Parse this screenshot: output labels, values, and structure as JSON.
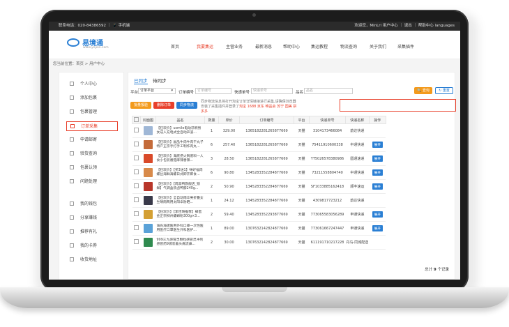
{
  "topbar": {
    "left": "联系电话：020-84386592 ｜ 📱 手机端",
    "right": "欢迎您，MinLrl  用户中心 ｜ 退出 ｜ 帮助中心 languages"
  },
  "logo": {
    "name": "易境通",
    "sub": "www.yejoin.com"
  },
  "nav": [
    "首页",
    "我要集运",
    "主营业务",
    "最新消息",
    "帮助中心",
    "集运教程",
    "物流查询",
    "关于我们",
    "采集插件"
  ],
  "breadcrumb": "您当前位置：首页 > 用户中心",
  "sidebar": [
    "个人中心",
    "添加包裹",
    "包裹管理",
    "订单采集",
    "申请邮寄",
    "验货查询",
    "包裹认领",
    "问题处理",
    "我的钱包",
    "分享赚钱",
    "推荐有礼",
    "我的卡券",
    "收货地址"
  ],
  "tabs": [
    "已同步",
    "待同步"
  ],
  "filters": {
    "platform_label": "平台",
    "platform_value": "订单平台",
    "order_label": "订单编号",
    "order_placeholder": "订单编号",
    "tracking_label": "快递单号",
    "tracking_placeholder": "快递单号",
    "name_label": "品名",
    "name_placeholder": "品名",
    "search_btn": "🔍 查询",
    "reset_btn": "↻ 重置"
  },
  "actions": [
    "批量报验",
    "删除订单",
    "同步物流"
  ],
  "notice": {
    "text": "同步物流信息将打开淘宝订单详情链接进行采集,请确保浏览器安装了采集插件并登录了淘宝 1688 京东 唯品会 苏宁 国美 拼多多",
    "highlight": "淘宝 1688 京东 唯品会 苏宁 国美 拼多多"
  },
  "table": {
    "headers": [
      "",
      "封面图",
      "品名",
      "数量",
      "单价",
      "订单编号",
      "平台",
      "快递单号",
      "快递名称",
      "操作"
    ],
    "rows": [
      {
        "name": "【狂欢价】usmile电动牙刷男女成人充电式全自动声波...",
        "qty": "1",
        "price": "329.00",
        "order": "1365182281265877669",
        "platform": "天猫",
        "tracking": "3104173466084",
        "courier": "韵达快递",
        "op": ""
      },
      {
        "name": "【狂欢价】副品牛肉牛肉干丸子特产正宗手打手工制作肉丸...",
        "qty": "6",
        "price": "257.40",
        "order": "1365182281265877669",
        "platform": "天猫",
        "tracking": "75411910600338",
        "courier": "中通快递",
        "op": "展开"
      },
      {
        "name": "【狂欢价】海底捞火锅底料一人食小包装番茄麻辣香辣...",
        "qty": "3",
        "price": "28.50",
        "order": "1365182281265877669",
        "platform": "天猫",
        "tracking": "YT5026578380986",
        "courier": "圆通速递",
        "op": "展开"
      },
      {
        "name": "【狂欢价】【买3送1】咪好福肉螺丝海鲜海螺日式即开即食...",
        "qty": "6",
        "price": "90.80",
        "order": "1345283352284877669",
        "platform": "天猫",
        "tracking": "73211558804740",
        "courier": "中通快递",
        "op": "展开"
      },
      {
        "name": "【狂欢价】【周黑鸭旗舰店_锁鲜】气调盒装卤鸭脖240g...",
        "qty": "2",
        "price": "50.90",
        "order": "1345283352284877669",
        "platform": "天猫",
        "tracking": "SF1033885162418",
        "courier": "顺丰速运",
        "op": "展开"
      },
      {
        "name": "【狂欢价】全自动雨伞男折叠女生晴雨两用太阳伞防晒...",
        "qty": "1",
        "price": "24.12",
        "order": "1345283352284877669",
        "platform": "天猫",
        "tracking": "4309817723212",
        "courier": "韵达快递",
        "op": ""
      },
      {
        "name": "【狂欢价】【李佳琦推荐】蜂蜜金正宗柳州螺蛳粉300g×3...",
        "qty": "2",
        "price": "59.40",
        "order": "1345283352293877669",
        "platform": "天猫",
        "tracking": "773065583056289",
        "courier": "申通快递",
        "op": "展开"
      },
      {
        "name": "海氏海諾医用外科口罩一次性医用医疗口罩医生外科医护...",
        "qty": "1",
        "price": "89.00",
        "order": "1307632142824877669",
        "platform": "天猫",
        "tracking": "773061667247447",
        "courier": "申通快递",
        "op": "展开"
      },
      {
        "name": "999三九感冒灵颗粒感冒灵冲剂感冒药9袋装着头痛流鼻...",
        "qty": "2",
        "price": "30.00",
        "order": "1307632142824877669",
        "platform": "天猫",
        "tracking": "611191710217228",
        "courier": "丹鸟-同城配送",
        "op": ""
      }
    ]
  },
  "total": {
    "label": "总计",
    "count": "9",
    "unit": "个记录"
  },
  "thumb_colors": [
    "#9fb7d6",
    "#c46b3a",
    "#d94a2a",
    "#d88a4a",
    "#b8362a",
    "#3a3a4a",
    "#d4a034",
    "#5aa2d8",
    "#2f8a4f"
  ]
}
